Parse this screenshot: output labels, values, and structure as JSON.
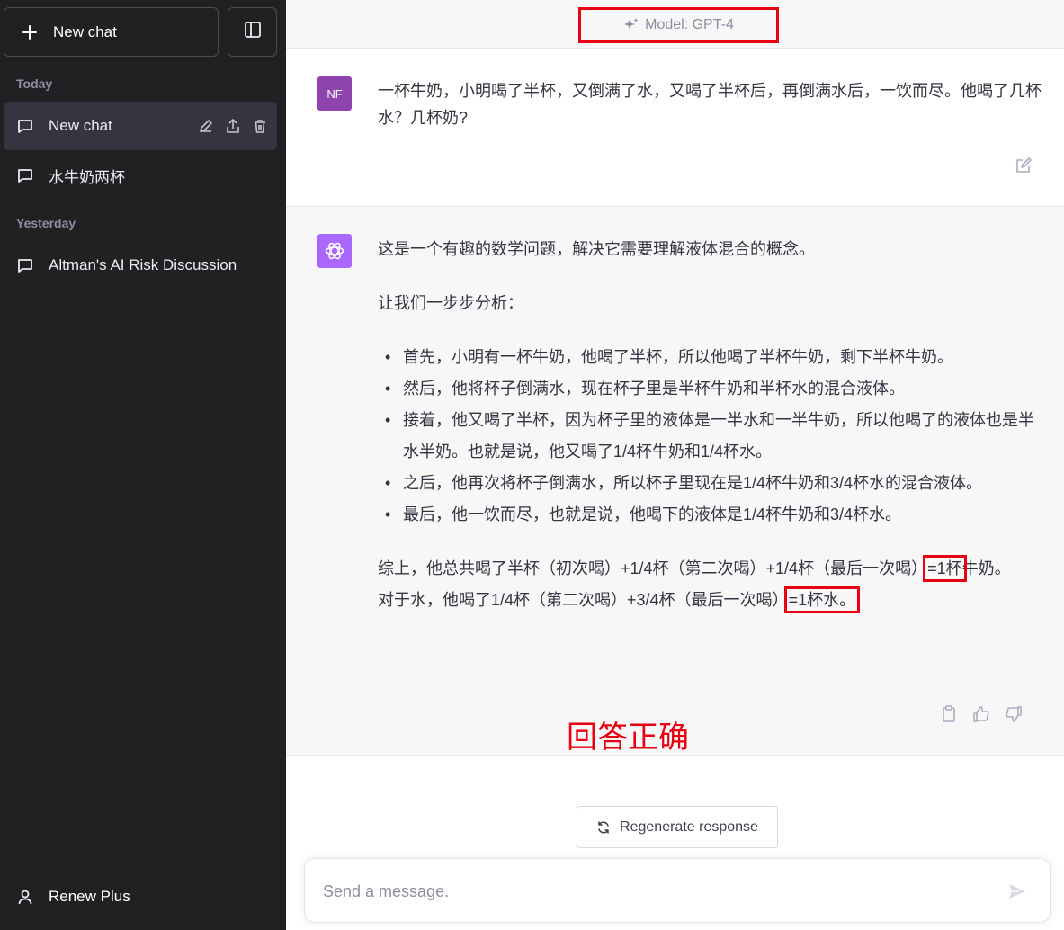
{
  "sidebar": {
    "new_chat_label": "New chat",
    "sections": [
      {
        "label": "Today"
      },
      {
        "label": "Yesterday"
      }
    ],
    "items": [
      {
        "label": "New chat"
      },
      {
        "label": "水牛奶两杯"
      },
      {
        "label": "Altman's AI Risk Discussion"
      }
    ],
    "account_label": "Renew Plus"
  },
  "header": {
    "model_label": "Model: GPT-4"
  },
  "conversation": {
    "user": {
      "avatar_initials": "NF",
      "message": "一杯牛奶，小明喝了半杯，又倒满了水，又喝了半杯后，再倒满水后，一饮而尽。他喝了几杯水？几杯奶?"
    },
    "assistant": {
      "intro": "这是一个有趣的数学问题，解决它需要理解液体混合的概念。",
      "lead": "让我们一步步分析：",
      "steps": [
        "首先，小明有一杯牛奶，他喝了半杯，所以他喝了半杯牛奶，剩下半杯牛奶。",
        "然后，他将杯子倒满水，现在杯子里是半杯牛奶和半杯水的混合液体。",
        "接着，他又喝了半杯，因为杯子里的液体是一半水和一半牛奶，所以他喝了的液体也是半水半奶。也就是说，他又喝了1/4杯牛奶和1/4杯水。",
        "之后，他再次将杯子倒满水，所以杯子里现在是1/4杯牛奶和3/4杯水的混合液体。",
        "最后，他一饮而尽，也就是说，他喝下的液体是1/4杯牛奶和3/4杯水。"
      ],
      "summary_milk_prefix": "综上，他总共喝了半杯（初次喝）+1/4杯（第二次喝）+1/4杯（最后一次喝）",
      "summary_milk_result": "=1杯",
      "summary_milk_suffix": "牛奶。",
      "summary_water_prefix": "对于水，他喝了1/4杯（第二次喝）+3/4杯（最后一次喝）",
      "summary_water_result": "=1杯水。"
    }
  },
  "annotation": "回答正确",
  "regenerate_label": "Regenerate response",
  "composer": {
    "placeholder": "Send a message."
  },
  "colors": {
    "sidebar_bg": "#202123",
    "highlight": "#e60012",
    "gpt_avatar": "#ab68ff",
    "user_avatar": "#8e44ad"
  }
}
